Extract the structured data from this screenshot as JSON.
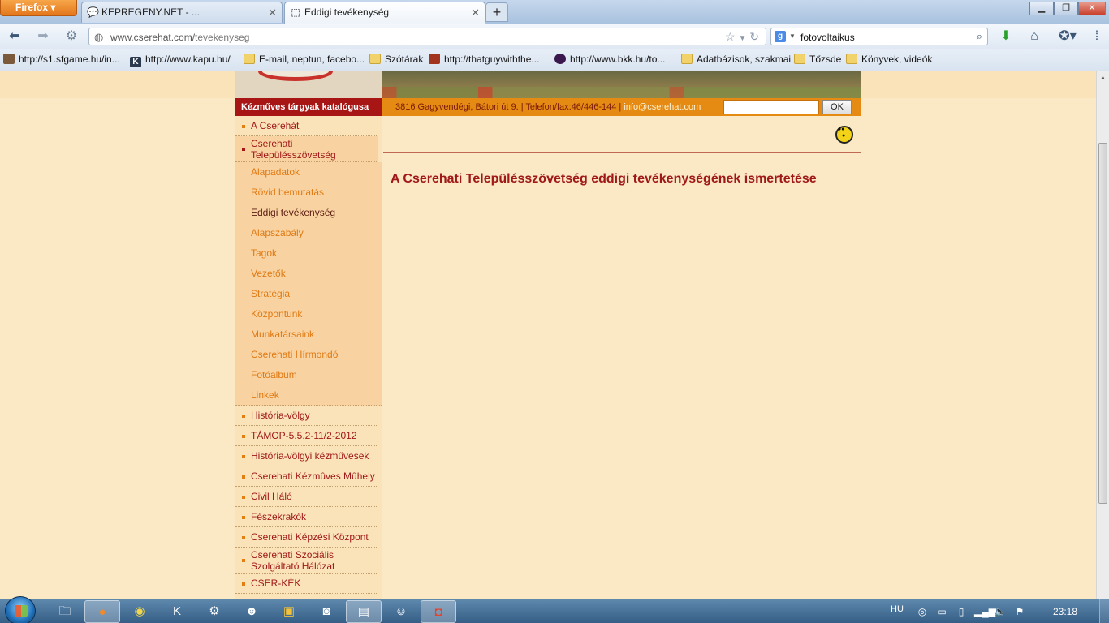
{
  "browser": {
    "menu_label": "Firefox",
    "tabs": [
      {
        "title": "KEPREGENY.NET - ...",
        "icon": "speech-bubble-icon"
      },
      {
        "title": "Eddigi tevékenység",
        "icon": "dotted-page-icon"
      }
    ],
    "new_tab_label": "+",
    "url_prefix": "www.cserehat.com/",
    "url_path": "tevekenyseg",
    "search_query": "fotovoltaikus",
    "search_engine_label": "g",
    "bookmarks": [
      {
        "label": "http://s1.sfgame.hu/in...",
        "icon": "avatar-icon"
      },
      {
        "label": "http://www.kapu.hu/",
        "icon": "k-icon"
      },
      {
        "label": "E-mail, neptun, facebo...",
        "icon": "folder-icon"
      },
      {
        "label": "Szótárak",
        "icon": "folder-icon"
      },
      {
        "label": "http://thatguywiththe...",
        "icon": "avatar-icon"
      },
      {
        "label": "http://www.bkk.hu/to...",
        "icon": "circle-icon"
      },
      {
        "label": "Adatbázisok, szakmai",
        "icon": "folder-icon"
      },
      {
        "label": "Tőzsde",
        "icon": "folder-icon"
      },
      {
        "label": "Könyvek, videók",
        "icon": "folder-icon"
      }
    ]
  },
  "site": {
    "sidebar_title": "Kézműves tárgyak katalógusa",
    "info_text": "3816 Gagyvendégi, Bátori út 9. | Telefon/fax:46/446-144 | ",
    "info_email": "info@cserehat.com",
    "search_button": "OK",
    "menu_top": [
      {
        "label": "A Cserehát"
      }
    ],
    "menu_active": {
      "line1": "Cserehati",
      "line2": "Településszövetség"
    },
    "submenu": [
      {
        "label": "Alapadatok"
      },
      {
        "label": "Rövid bemutatás"
      },
      {
        "label": "Eddigi tevékenység"
      },
      {
        "label": "Alapszabály"
      },
      {
        "label": "Tagok"
      },
      {
        "label": "Vezetők"
      },
      {
        "label": "Stratégia"
      },
      {
        "label": "Központunk"
      },
      {
        "label": "Munkatársaink"
      },
      {
        "label": "Cserehati Hírmondó"
      },
      {
        "label": "Fotóalbum"
      },
      {
        "label": "Linkek"
      }
    ],
    "menu_bottom": [
      {
        "label": "História-völgy"
      },
      {
        "label": "TÁMOP-5.5.2-11/2-2012"
      },
      {
        "label": "História-völgyi kézművesek"
      },
      {
        "label": "Cserehati Kézmûves Mûhely"
      },
      {
        "label": "Civil Háló"
      },
      {
        "label": "Fészekrakók"
      },
      {
        "label": "Cserehati Képzési Központ"
      }
    ],
    "menu_two_line": {
      "line1": "Cserehati Szociális",
      "line2": "Szolgáltató Hálózat"
    },
    "menu_last": {
      "label": "CSER-KÉK"
    },
    "page_title": "A Cserehati Településszövetség eddigi tevékenységének ismertetése"
  },
  "taskbar": {
    "language": "HU",
    "clock": "23:18"
  }
}
